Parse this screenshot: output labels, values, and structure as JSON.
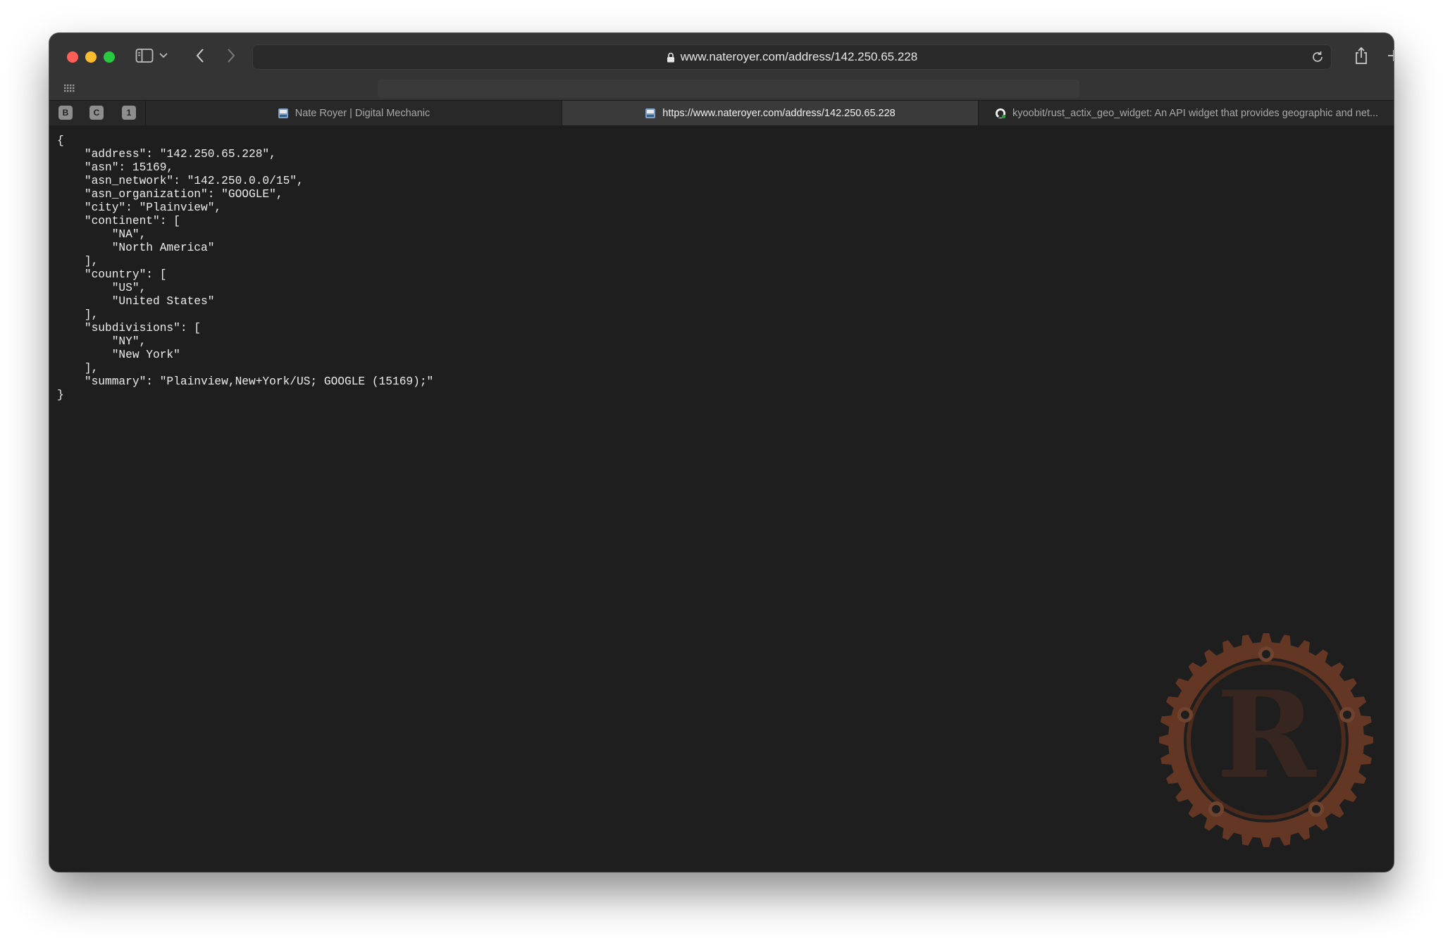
{
  "browser": {
    "url": "www.nateroyer.com/address/142.250.65.228",
    "pinned_tabs": [
      "B",
      "C",
      "1"
    ],
    "tabs": [
      {
        "title": "Nate Royer | Digital Mechanic",
        "active": false
      },
      {
        "title": "https://www.nateroyer.com/address/142.250.65.228",
        "active": true
      },
      {
        "title": "kyoobit/rust_actix_geo_widget: An API widget that provides geographic and net...",
        "active": false
      }
    ],
    "icons": [
      "sidebar-icon",
      "chevron-down-icon",
      "back-icon",
      "forward-icon",
      "lock-icon",
      "reload-icon",
      "share-icon",
      "plus-icon",
      "tab-overview-icon",
      "grid-icon",
      "github-icon"
    ]
  },
  "page": {
    "json_text": "{\n    \"address\": \"142.250.65.228\",\n    \"asn\": 15169,\n    \"asn_network\": \"142.250.0.0/15\",\n    \"asn_organization\": \"GOOGLE\",\n    \"city\": \"Plainview\",\n    \"continent\": [\n        \"NA\",\n        \"North America\"\n    ],\n    \"country\": [\n        \"US\",\n        \"United States\"\n    ],\n    \"subdivisions\": [\n        \"NY\",\n        \"New York\"\n    ],\n    \"summary\": \"Plainview,New+York/US; GOOGLE (15169);\"\n}",
    "watermark_letter": "R",
    "watermark_color": "#c25a2c"
  }
}
